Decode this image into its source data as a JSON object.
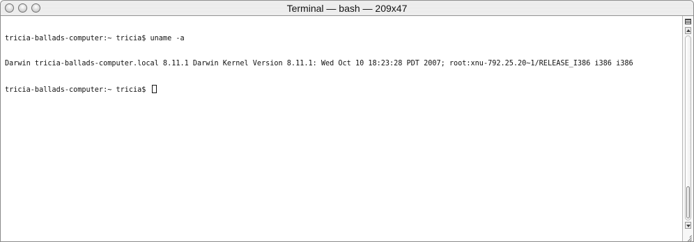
{
  "window": {
    "title": "Terminal — bash — 209x47"
  },
  "terminal": {
    "lines": [
      "tricia-ballads-computer:~ tricia$ uname -a",
      "Darwin tricia-ballads-computer.local 8.11.1 Darwin Kernel Version 8.11.1: Wed Oct 10 18:23:28 PDT 2007; root:xnu-792.25.20~1/RELEASE_I386 i386 i386",
      "tricia-ballads-computer:~ tricia$ "
    ]
  },
  "icons": {
    "close": "close-icon",
    "minimize": "minimize-icon",
    "zoom": "zoom-icon",
    "split": "split-pane-icon",
    "scroll_up": "arrow-up-icon",
    "scroll_down": "arrow-down-icon",
    "resize": "resize-grip-icon"
  },
  "colors": {
    "text": "#111111",
    "background": "#ffffff",
    "titlebar": "#e6e6e6"
  }
}
